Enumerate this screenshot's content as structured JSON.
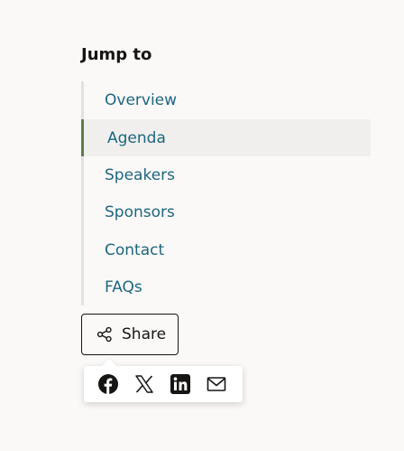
{
  "jump_to": {
    "title": "Jump to",
    "items": [
      {
        "label": "Overview",
        "active": false
      },
      {
        "label": "Agenda",
        "active": true
      },
      {
        "label": "Speakers",
        "active": false
      },
      {
        "label": "Sponsors",
        "active": false
      },
      {
        "label": "Contact",
        "active": false
      },
      {
        "label": "FAQs",
        "active": false
      }
    ]
  },
  "share": {
    "button_label": "Share",
    "button_icon": "share-icon",
    "options": [
      {
        "icon": "facebook-icon"
      },
      {
        "icon": "x-twitter-icon"
      },
      {
        "icon": "linkedin-icon"
      },
      {
        "icon": "email-icon"
      }
    ]
  },
  "colors": {
    "link": "#1d6680",
    "active_indicator": "#5e7e4c",
    "active_background": "#f1efed",
    "rail": "#e4e1dd",
    "text_dark": "#161513",
    "page_background": "#fbf9f8"
  }
}
